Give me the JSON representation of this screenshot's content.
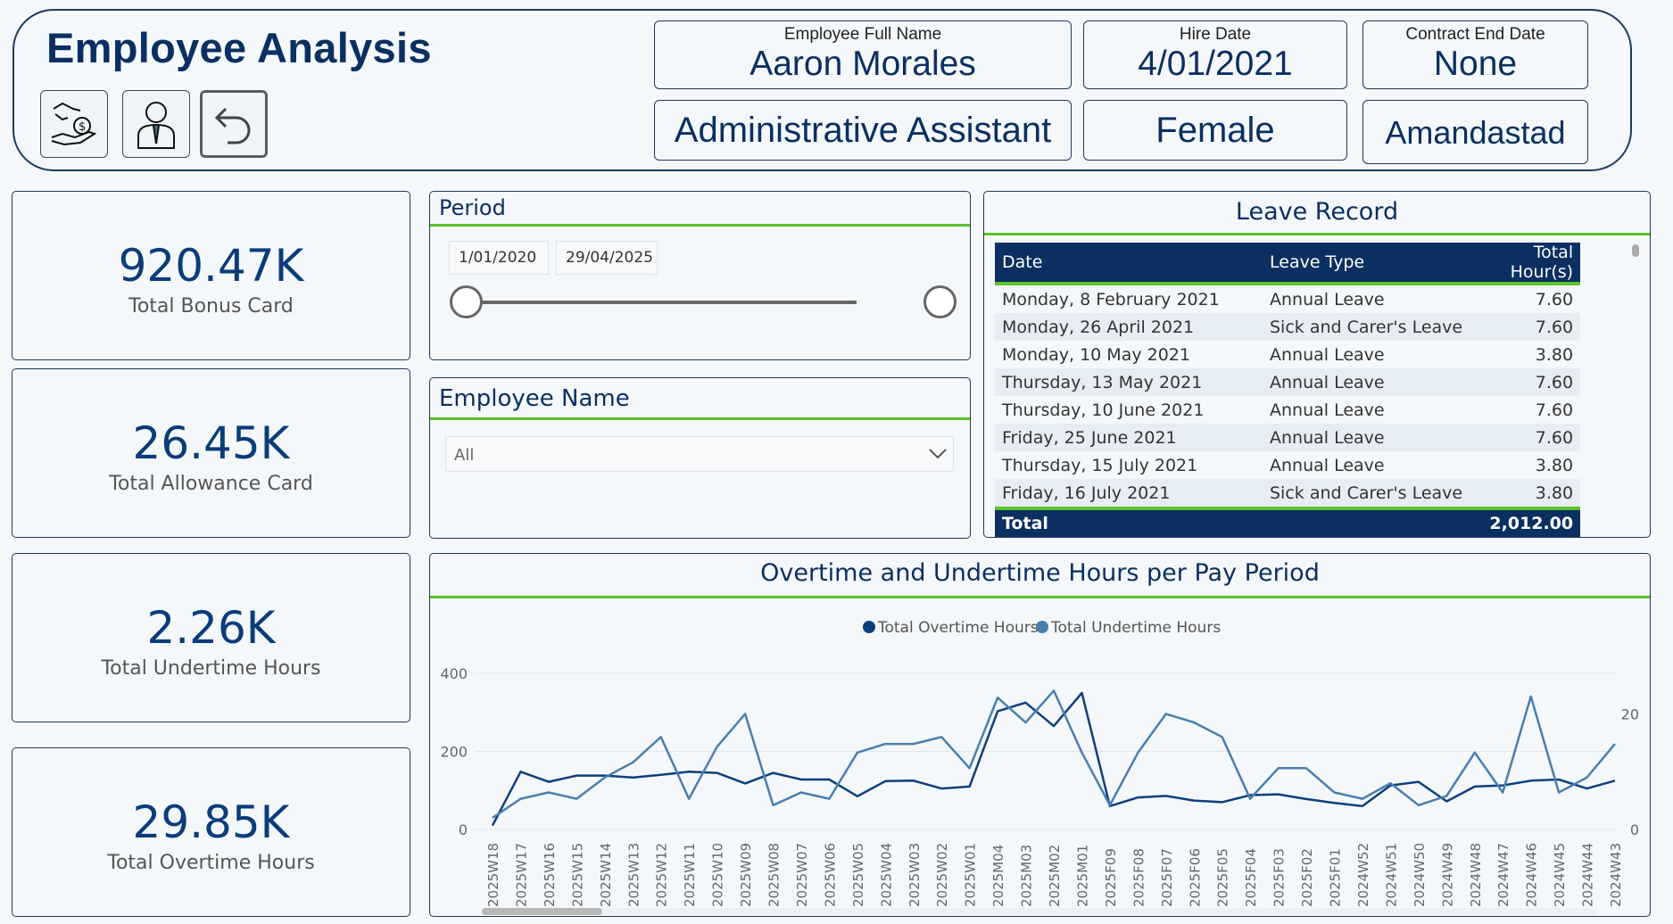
{
  "header": {
    "title": "Employee Analysis",
    "employee_full_name_label": "Employee Full Name",
    "employee_full_name": "Aaron Morales",
    "hire_date_label": "Hire Date",
    "hire_date": "4/01/2021",
    "contract_end_label": "Contract End Date",
    "contract_end": "None",
    "position": "Administrative Assistant",
    "gender": "Female",
    "location": "Amandastad"
  },
  "nav_buttons": [
    {
      "icon": "money-hand-icon"
    },
    {
      "icon": "employee-icon"
    },
    {
      "icon": "back-arrow-icon"
    }
  ],
  "kpis": [
    {
      "value": "920.47K",
      "label": "Total Bonus Card"
    },
    {
      "value": "26.45K",
      "label": "Total Allowance Card"
    },
    {
      "value": "2.26K",
      "label": "Total Undertime Hours"
    },
    {
      "value": "29.85K",
      "label": "Total Overtime Hours"
    }
  ],
  "period": {
    "title": "Period",
    "start": "1/01/2020",
    "end": "29/04/2025"
  },
  "employee_slicer": {
    "title": "Employee Name",
    "selected": "All"
  },
  "leave_record": {
    "title": "Leave Record",
    "columns": [
      "Date",
      "Leave Type",
      "Total Hour(s)"
    ],
    "rows": [
      [
        "Monday, 8 February 2021",
        "Annual Leave",
        "7.60"
      ],
      [
        "Monday, 26 April 2021",
        "Sick and Carer's Leave",
        "7.60"
      ],
      [
        "Monday, 10 May 2021",
        "Annual Leave",
        "3.80"
      ],
      [
        "Thursday, 13 May 2021",
        "Annual Leave",
        "7.60"
      ],
      [
        "Thursday, 10 June 2021",
        "Annual Leave",
        "7.60"
      ],
      [
        "Friday, 25 June 2021",
        "Annual Leave",
        "7.60"
      ],
      [
        "Thursday, 15 July 2021",
        "Annual Leave",
        "3.80"
      ],
      [
        "Friday, 16 July 2021",
        "Sick and Carer's Leave",
        "3.80"
      ]
    ],
    "total_label": "Total",
    "total_value": "2,012.00"
  },
  "colors": {
    "navy": "#0b2f60",
    "green_accent": "#5cc22e",
    "overtime_line": "#0e3f7c",
    "undertime_line": "#4a7ead"
  },
  "chart_data": {
    "type": "line",
    "title": "Overtime and Undertime Hours per Pay Period",
    "x": [
      "2025W18",
      "2025W17",
      "2025W16",
      "2025W15",
      "2025W14",
      "2025W13",
      "2025W12",
      "2025W11",
      "2025W10",
      "2025W09",
      "2025W08",
      "2025W07",
      "2025W06",
      "2025W05",
      "2025W04",
      "2025W03",
      "2025W02",
      "2025W01",
      "2025M04",
      "2025M03",
      "2025M02",
      "2025M01",
      "2025F09",
      "2025F08",
      "2025F07",
      "2025F06",
      "2025F05",
      "2025F04",
      "2025F03",
      "2025F02",
      "2025F01",
      "2024W52",
      "2024W51",
      "2024W50",
      "2024W49",
      "2024W48",
      "2024W47",
      "2024W46",
      "2024W45",
      "2024W44",
      "2024W43"
    ],
    "series": [
      {
        "name": "Total Overtime Hours",
        "axis": "left",
        "color": "#0e3f7c",
        "values": [
          10,
          148,
          122,
          138,
          138,
          133,
          140,
          148,
          145,
          118,
          145,
          128,
          128,
          85,
          124,
          125,
          105,
          110,
          303,
          325,
          265,
          350,
          60,
          82,
          86,
          74,
          70,
          88,
          90,
          78,
          68,
          60,
          113,
          122,
          72,
          110,
          113,
          125,
          128,
          105,
          125
        ]
      },
      {
        "name": "Total Undertime Hours",
        "axis": "right",
        "color": "#4a7ead",
        "values": [
          2,
          5.3,
          6.4,
          5.3,
          9,
          11.6,
          16,
          5.3,
          14.3,
          20,
          4.2,
          6.4,
          5.3,
          13.3,
          14.8,
          14.8,
          16,
          10.6,
          22.8,
          18.5,
          24,
          13.3,
          4.2,
          13.3,
          20,
          18.5,
          16,
          5.3,
          10.6,
          10.6,
          6.4,
          5.3,
          8,
          4.2,
          5.8,
          13.3,
          6.4,
          23,
          6.4,
          9,
          14.8
        ]
      }
    ],
    "y_left": {
      "ticks": [
        0,
        200,
        400
      ],
      "range": [
        0,
        400
      ]
    },
    "y_right": {
      "ticks": [
        0,
        20
      ],
      "range": [
        0,
        27
      ]
    },
    "legend": "top-center",
    "grid": true
  }
}
